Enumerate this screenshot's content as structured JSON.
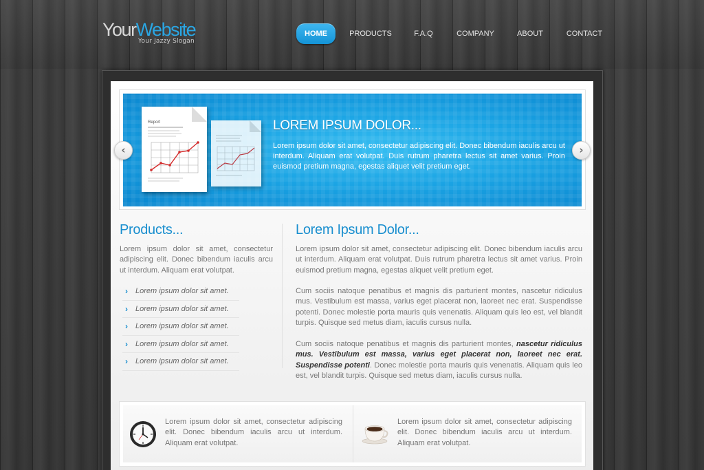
{
  "header": {
    "logo_your": "Your",
    "logo_website": "Website",
    "slogan": "Your Jazzy Slogan"
  },
  "nav": {
    "items": [
      {
        "label": "HOME",
        "active": true
      },
      {
        "label": "PRODUCTS"
      },
      {
        "label": "F.A.Q"
      },
      {
        "label": "COMPANY"
      },
      {
        "label": "ABOUT"
      },
      {
        "label": "CONTACT"
      }
    ]
  },
  "slider": {
    "title": "LOREM IPSUM DOLOR...",
    "text": "Lorem ipsum dolor sit amet, consectetur adipiscing elit. Donec bibendum iaculis arcu ut interdum. Aliquam erat volutpat. Duis rutrum pharetra lectus sit amet varius. Proin euismod pretium magna, egestas aliquet velit pretium eget.",
    "report_label": "Report",
    "prev_icon": "chevron-left-icon",
    "next_icon": "chevron-right-icon",
    "prev_glyph": "‹",
    "next_glyph": "›"
  },
  "products": {
    "heading": "Products...",
    "intro": "Lorem ipsum dolor sit amet, consectetur adipiscing elit. Donec bibendum iaculis arcu ut interdum. Aliquam erat volutpat.",
    "items": [
      "Lorem ipsum dolor sit amet.",
      "Lorem ipsum dolor sit amet.",
      "Lorem ipsum dolor sit amet.",
      "Lorem ipsum dolor sit amet.",
      "Lorem ipsum dolor sit amet."
    ]
  },
  "main": {
    "heading": "Lorem Ipsum Dolor...",
    "para1": "Lorem ipsum dolor sit amet, consectetur adipiscing elit. Donec bibendum iaculis arcu ut interdum. Aliquam erat volutpat. Duis rutrum pharetra lectus sit amet varius. Proin euismod pretium magna, egestas aliquet velit pretium eget.",
    "para2": "Cum sociis natoque penatibus et magnis dis parturient montes, nascetur ridiculus mus. Vestibulum est massa, varius eget placerat non, laoreet nec erat. Suspendisse potenti. Donec molestie porta mauris quis venenatis. Aliquam quis leo est, vel blandit turpis. Quisque sed metus diam, iaculis cursus nulla.",
    "para3_start": "Cum sociis natoque penatibus et magnis dis parturient montes, ",
    "para3_bold": "nascetur ridiculus mus. Vestibulum est massa, varius eget placerat non, laoreet nec erat. Suspendisse potenti",
    "para3_end": ". Donec molestie porta mauris quis venenatis. Aliquam quis leo est, vel blandit turpis. Quisque sed metus diam, iaculis cursus nulla."
  },
  "features": [
    {
      "icon": "clock-icon",
      "text": "Lorem ipsum dolor sit amet, consectetur adipiscing elit. Donec bibendum iaculis arcu ut interdum. Aliquam erat volutpat."
    },
    {
      "icon": "coffee-cup-icon",
      "text": "Lorem ipsum dolor sit amet, consectetur adipiscing elit. Donec bibendum iaculis arcu ut interdum. Aliquam erat volutpat."
    }
  ],
  "colors": {
    "accent": "#1a8fcf",
    "nav_active": "#1ea3e6",
    "slider_blue": "#1ba4e4"
  }
}
